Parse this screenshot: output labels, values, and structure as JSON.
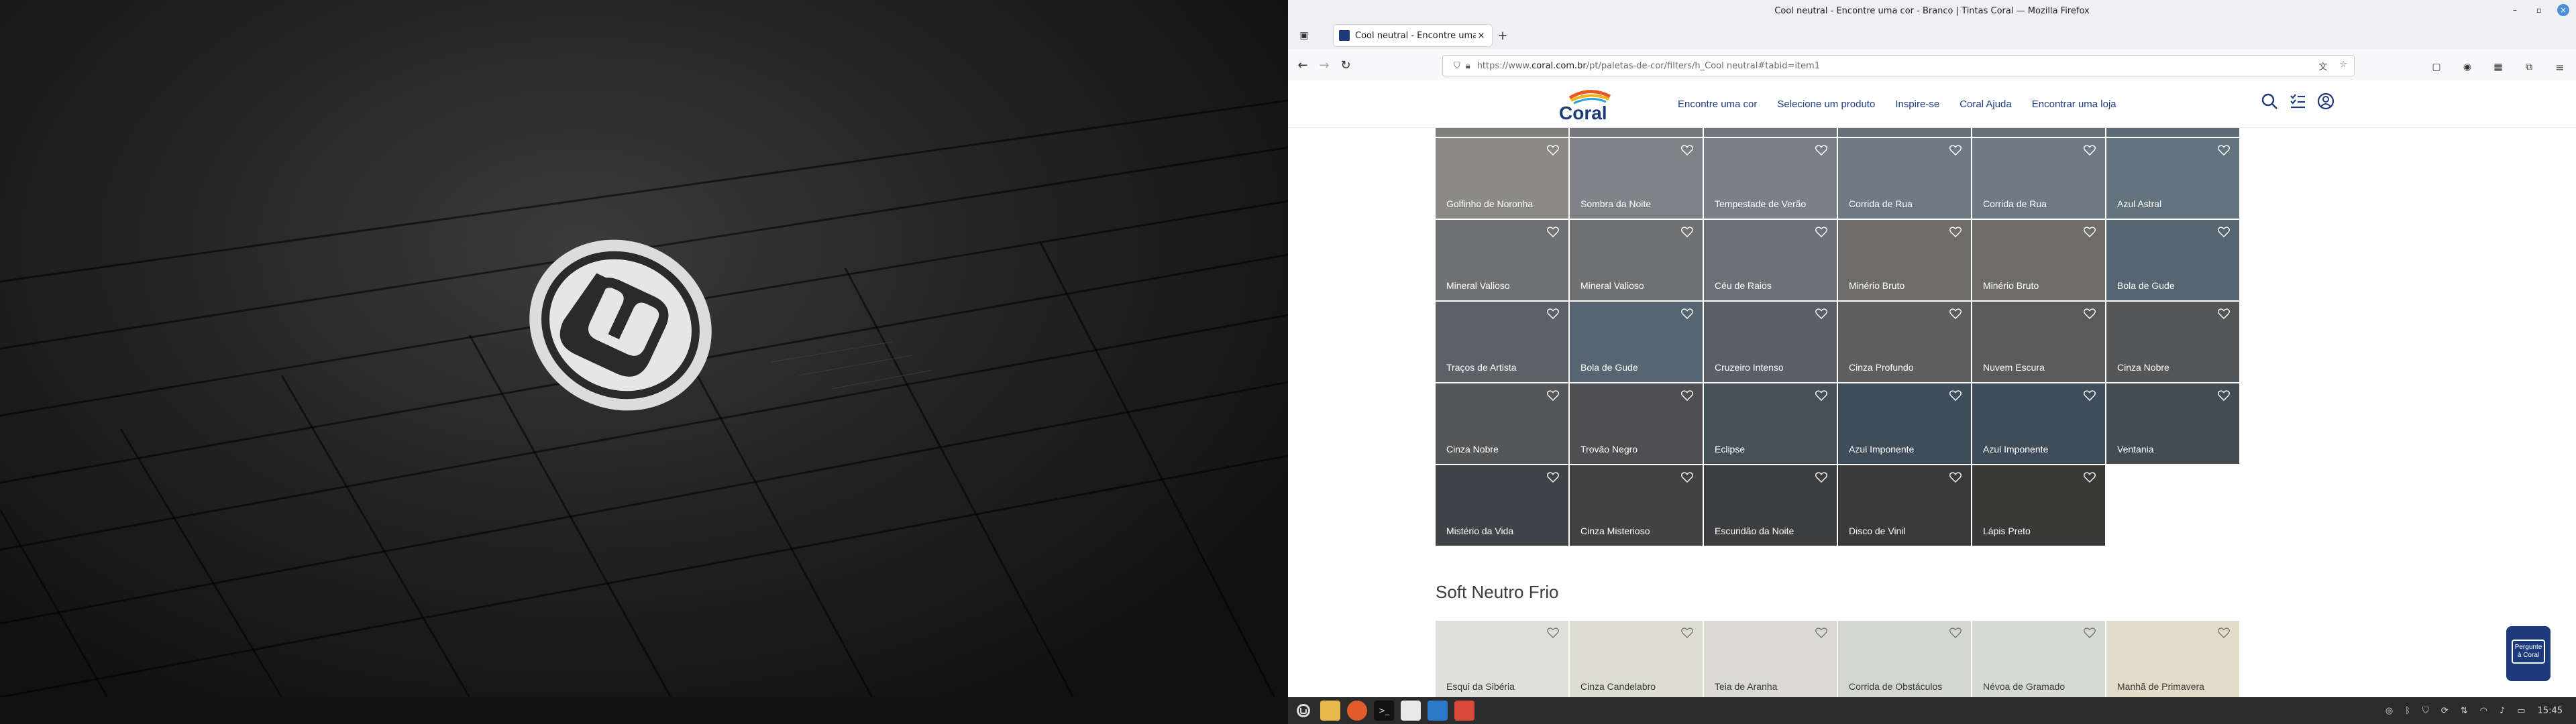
{
  "window": {
    "title": "Cool neutral - Encontre uma cor - Branco | Tintas Coral — Mozilla Firefox"
  },
  "tab": {
    "label": "Cool neutral - Encontre uma c",
    "close": "×",
    "new": "+"
  },
  "url": {
    "prefix": "https://www.",
    "domain": "coral.com.br",
    "path": "/pt/paletas-de-cor/filters/h_Cool neutral#tabid=item1"
  },
  "site": {
    "logo_text": "Coral",
    "nav": [
      "Encontre uma cor",
      "Selecione um produto",
      "Inspire-se",
      "Coral Ajuda",
      "Encontrar uma loja"
    ]
  },
  "swatch_grid": [
    {
      "name": "Golfinho de Noronha",
      "color": "#8b8a86"
    },
    {
      "name": "Sombra da Noite",
      "color": "#7f8388"
    },
    {
      "name": "Tempestade de Verão",
      "color": "#7a8086"
    },
    {
      "name": "Corrida de Rua",
      "color": "#6f7a84"
    },
    {
      "name": "Corrida de Rua",
      "color": "#6f7a84"
    },
    {
      "name": "Azul Astral",
      "color": "#64747f"
    },
    {
      "name": "Mineral Valioso",
      "color": "#6f7072"
    },
    {
      "name": "Mineral Valioso",
      "color": "#6f7072"
    },
    {
      "name": "Céu de Raios",
      "color": "#6c7177"
    },
    {
      "name": "Minério Bruto",
      "color": "#6e6c69"
    },
    {
      "name": "Minério Bruto",
      "color": "#6e6c69"
    },
    {
      "name": "Bola de Gude",
      "color": "#576573"
    },
    {
      "name": "Traços de Artista",
      "color": "#5b6166"
    },
    {
      "name": "Bola de Gude",
      "color": "#576573"
    },
    {
      "name": "Cruzeiro Intenso",
      "color": "#5a5f66"
    },
    {
      "name": "Cinza Profundo",
      "color": "#5e5e5e"
    },
    {
      "name": "Nuvem Escura",
      "color": "#5a5a5b"
    },
    {
      "name": "Cinza Nobre",
      "color": "#555657"
    },
    {
      "name": "Cinza Nobre",
      "color": "#555657"
    },
    {
      "name": "Trovão Negro",
      "color": "#4f4f51"
    },
    {
      "name": "Eclipse",
      "color": "#465058"
    },
    {
      "name": "Azul Imponente",
      "color": "#3f4d5a"
    },
    {
      "name": "Azul Imponente",
      "color": "#3f4d5a"
    },
    {
      "name": "Ventania",
      "color": "#434b53"
    },
    {
      "name": "Mistério da Vida",
      "color": "#3f4448"
    },
    {
      "name": "Cinza Misterioso",
      "color": "#424242"
    },
    {
      "name": "Escuridão da Noite",
      "color": "#3d3e40"
    },
    {
      "name": "Disco de Vinil",
      "color": "#3a3a3a"
    },
    {
      "name": "Lápis Preto",
      "color": "#393938"
    }
  ],
  "section2": {
    "title": "Soft Neutro Frio",
    "swatches": [
      {
        "name": "Esqui da Sibéria",
        "color": "#dfe0da"
      },
      {
        "name": "Cinza Candelabro",
        "color": "#dcdcd3"
      },
      {
        "name": "Teia de Aranha",
        "color": "#dadad2"
      },
      {
        "name": "Corrida de Obstáculos",
        "color": "#d4d7d1"
      },
      {
        "name": "Névoa de Gramado",
        "color": "#d6dad2"
      },
      {
        "name": "Manhã de Primavera",
        "color": "#e0dcc9"
      }
    ]
  },
  "chat": {
    "line1": "Pergunte",
    "line2": "à Coral"
  },
  "taskbar": {
    "clock": "15:45"
  },
  "colors": {
    "brand": "#1d3b7a"
  }
}
